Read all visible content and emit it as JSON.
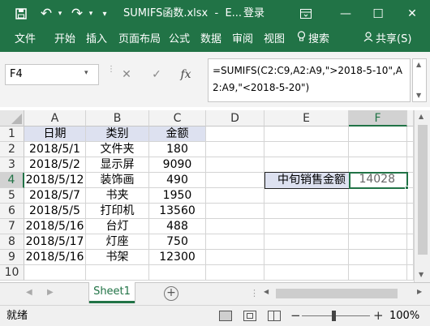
{
  "window": {
    "title": "SUMIFS函数.xlsx  -  E...",
    "login": "登录",
    "minimize": "—",
    "maximize": "☐",
    "close": "✕"
  },
  "ribbon": {
    "tabs": [
      "文件",
      "开始",
      "插入",
      "页面布局",
      "公式",
      "数据",
      "审阅",
      "视图"
    ],
    "search": "搜索",
    "share": "共享(S)"
  },
  "formula_bar": {
    "name_box": "F4",
    "cancel": "✕",
    "confirm": "✓",
    "fx": "fx",
    "formula": "=SUMIFS(C2:C9,A2:A9,\">2018-5-10\",A2:A9,\"<2018-5-20\")"
  },
  "columns": [
    "A",
    "B",
    "C",
    "D",
    "E",
    "F"
  ],
  "rows": [
    "1",
    "2",
    "3",
    "4",
    "5",
    "6",
    "7",
    "8",
    "9",
    "10"
  ],
  "table": {
    "headers": [
      "日期",
      "类别",
      "金额"
    ],
    "rows": [
      [
        "2018/5/1",
        "文件夹",
        "180"
      ],
      [
        "2018/5/2",
        "显示屏",
        "9090"
      ],
      [
        "2018/5/12",
        "装饰画",
        "490"
      ],
      [
        "2018/5/7",
        "书夹",
        "1950"
      ],
      [
        "2018/5/5",
        "打印机",
        "13560"
      ],
      [
        "2018/5/16",
        "台灯",
        "488"
      ],
      [
        "2018/5/17",
        "灯座",
        "750"
      ],
      [
        "2018/5/16",
        "书架",
        "12300"
      ]
    ]
  },
  "summary": {
    "label": "中旬销售金额",
    "value": "14028"
  },
  "sheets": {
    "active": "Sheet1",
    "add": "+"
  },
  "status": {
    "ready": "就绪",
    "zoom": "100%",
    "zoom_minus": "−",
    "zoom_plus": "+"
  },
  "colors": {
    "accent": "#217346",
    "header_fill": "#dde1f0"
  }
}
